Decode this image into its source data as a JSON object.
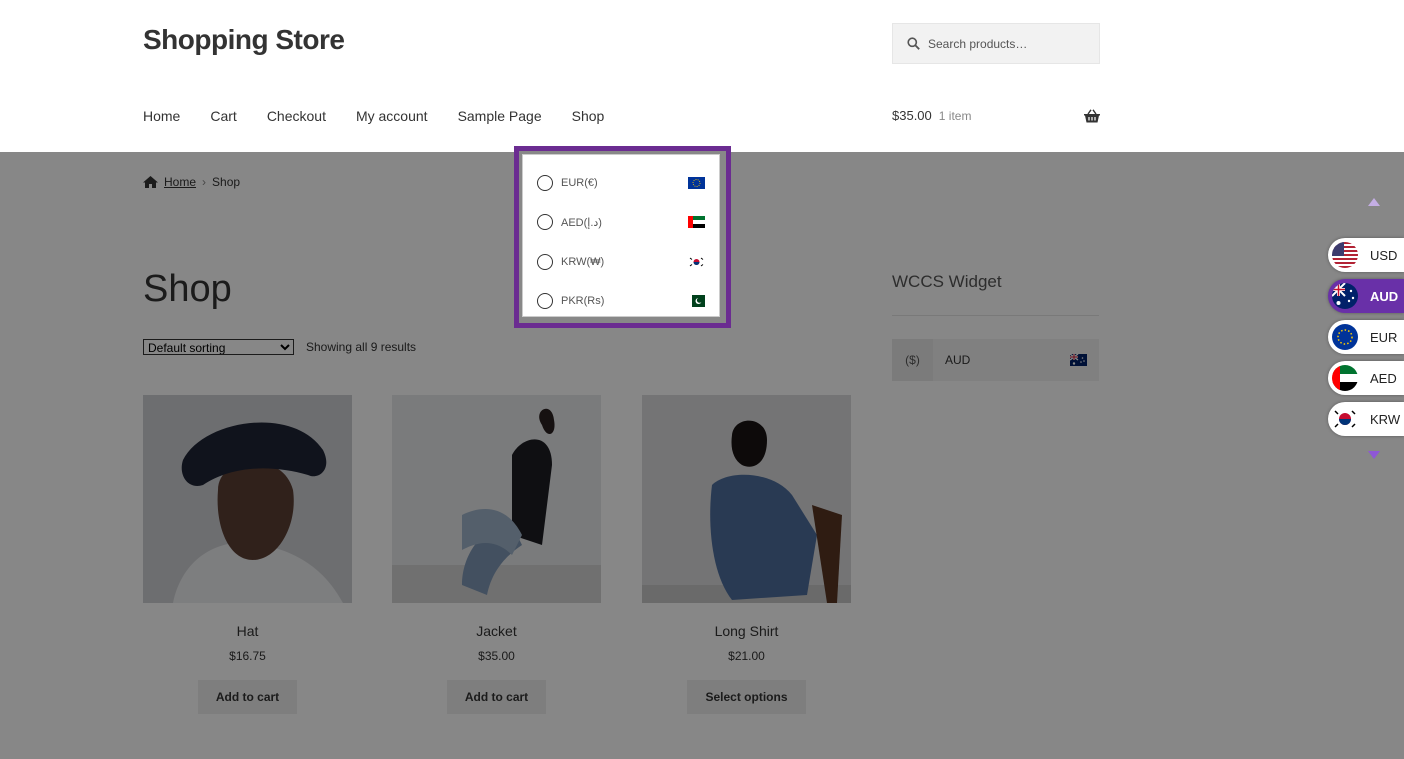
{
  "site": {
    "title": "Shopping Store"
  },
  "search": {
    "placeholder": "Search products…"
  },
  "nav": {
    "items": [
      {
        "label": "Home"
      },
      {
        "label": "Cart"
      },
      {
        "label": "Checkout"
      },
      {
        "label": "My account"
      },
      {
        "label": "Sample Page"
      },
      {
        "label": "Shop"
      }
    ]
  },
  "cart": {
    "amount": "$35.00",
    "items": "1 item"
  },
  "breadcrumb": {
    "home": "Home",
    "separator": "›",
    "current": "Shop"
  },
  "page": {
    "title": "Shop"
  },
  "sorting": {
    "selected": "Default sorting"
  },
  "results": {
    "text": "Showing all 9 results"
  },
  "products": [
    {
      "name": "Hat",
      "price": "$16.75",
      "button": "Add to cart"
    },
    {
      "name": "Jacket",
      "price": "$35.00",
      "button": "Add to cart"
    },
    {
      "name": "Long Shirt",
      "price": "$21.00",
      "button": "Select options"
    }
  ],
  "widget": {
    "title": "WCCS Widget",
    "symbol": "($)",
    "code": "AUD"
  },
  "dropdown": {
    "items": [
      {
        "label": "EUR(€)",
        "flag": "eu-flag-icon"
      },
      {
        "label": "AED(د.إ)",
        "flag": "uae-flag-icon"
      },
      {
        "label": "KRW(₩)",
        "flag": "korea-flag-icon"
      },
      {
        "label": "PKR(Rs)",
        "flag": "pakistan-flag-icon"
      }
    ],
    "border_color": "#6b2c91"
  },
  "switcher": {
    "items": [
      {
        "code": "USD",
        "active": false
      },
      {
        "code": "AUD",
        "active": true
      },
      {
        "code": "EUR",
        "active": false
      },
      {
        "code": "AED",
        "active": false
      },
      {
        "code": "KRW",
        "active": false
      }
    ],
    "accent": "#6930a8"
  }
}
